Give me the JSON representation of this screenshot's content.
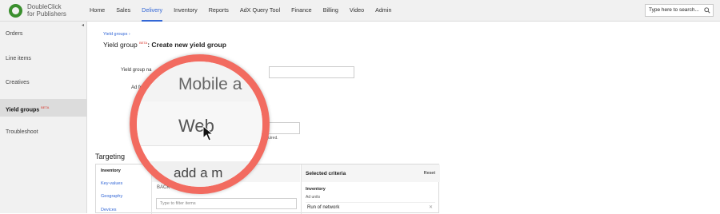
{
  "app": {
    "logo_line1": "DoubleClick",
    "logo_line2": "for Publishers",
    "brand_color": "#3a8f2e",
    "accent_color": "#3367d6"
  },
  "nav": {
    "items": [
      "Home",
      "Sales",
      "Delivery",
      "Inventory",
      "Reports",
      "AdX Query Tool",
      "Finance",
      "Billing",
      "Video",
      "Admin"
    ],
    "active": "Delivery"
  },
  "search": {
    "placeholder": "Type here to search...",
    "icon": "search-icon"
  },
  "sidebar": {
    "items": [
      {
        "label": "Orders"
      },
      {
        "label": "Line items"
      },
      {
        "label": "Creatives"
      },
      {
        "label": "Yield groups",
        "badge": "BETA"
      },
      {
        "label": "Troubleshoot"
      }
    ],
    "active": "Yield groups"
  },
  "main": {
    "breadcrumb": "Yield groups",
    "breadcrumb_sep": "›",
    "title_prefix": "Yield group",
    "title_badge": "BETA",
    "title_main": ": Create new yield group",
    "form": {
      "name_label": "Yield group na",
      "ad_format_label": "Ad fo",
      "required_note": "s is required."
    }
  },
  "targeting": {
    "heading": "Targeting",
    "side_items": [
      "Inventory",
      "Key-values",
      "Geography",
      "Devices"
    ],
    "selected_side": "Inventory",
    "mid_header": "add a m",
    "back_label": "BACK",
    "filter_placeholder": "Type to filter items",
    "selected_criteria_title": "Selected criteria",
    "reset_label": "Reset",
    "inventory_heading": "Inventory",
    "ad_units_label": "Ad units",
    "selected_item": "Run of network"
  },
  "magnifier": {
    "option_mobile": "Mobile a",
    "option_web": "Web",
    "bottom_text": "add a m",
    "ring_color": "#f26b60"
  }
}
